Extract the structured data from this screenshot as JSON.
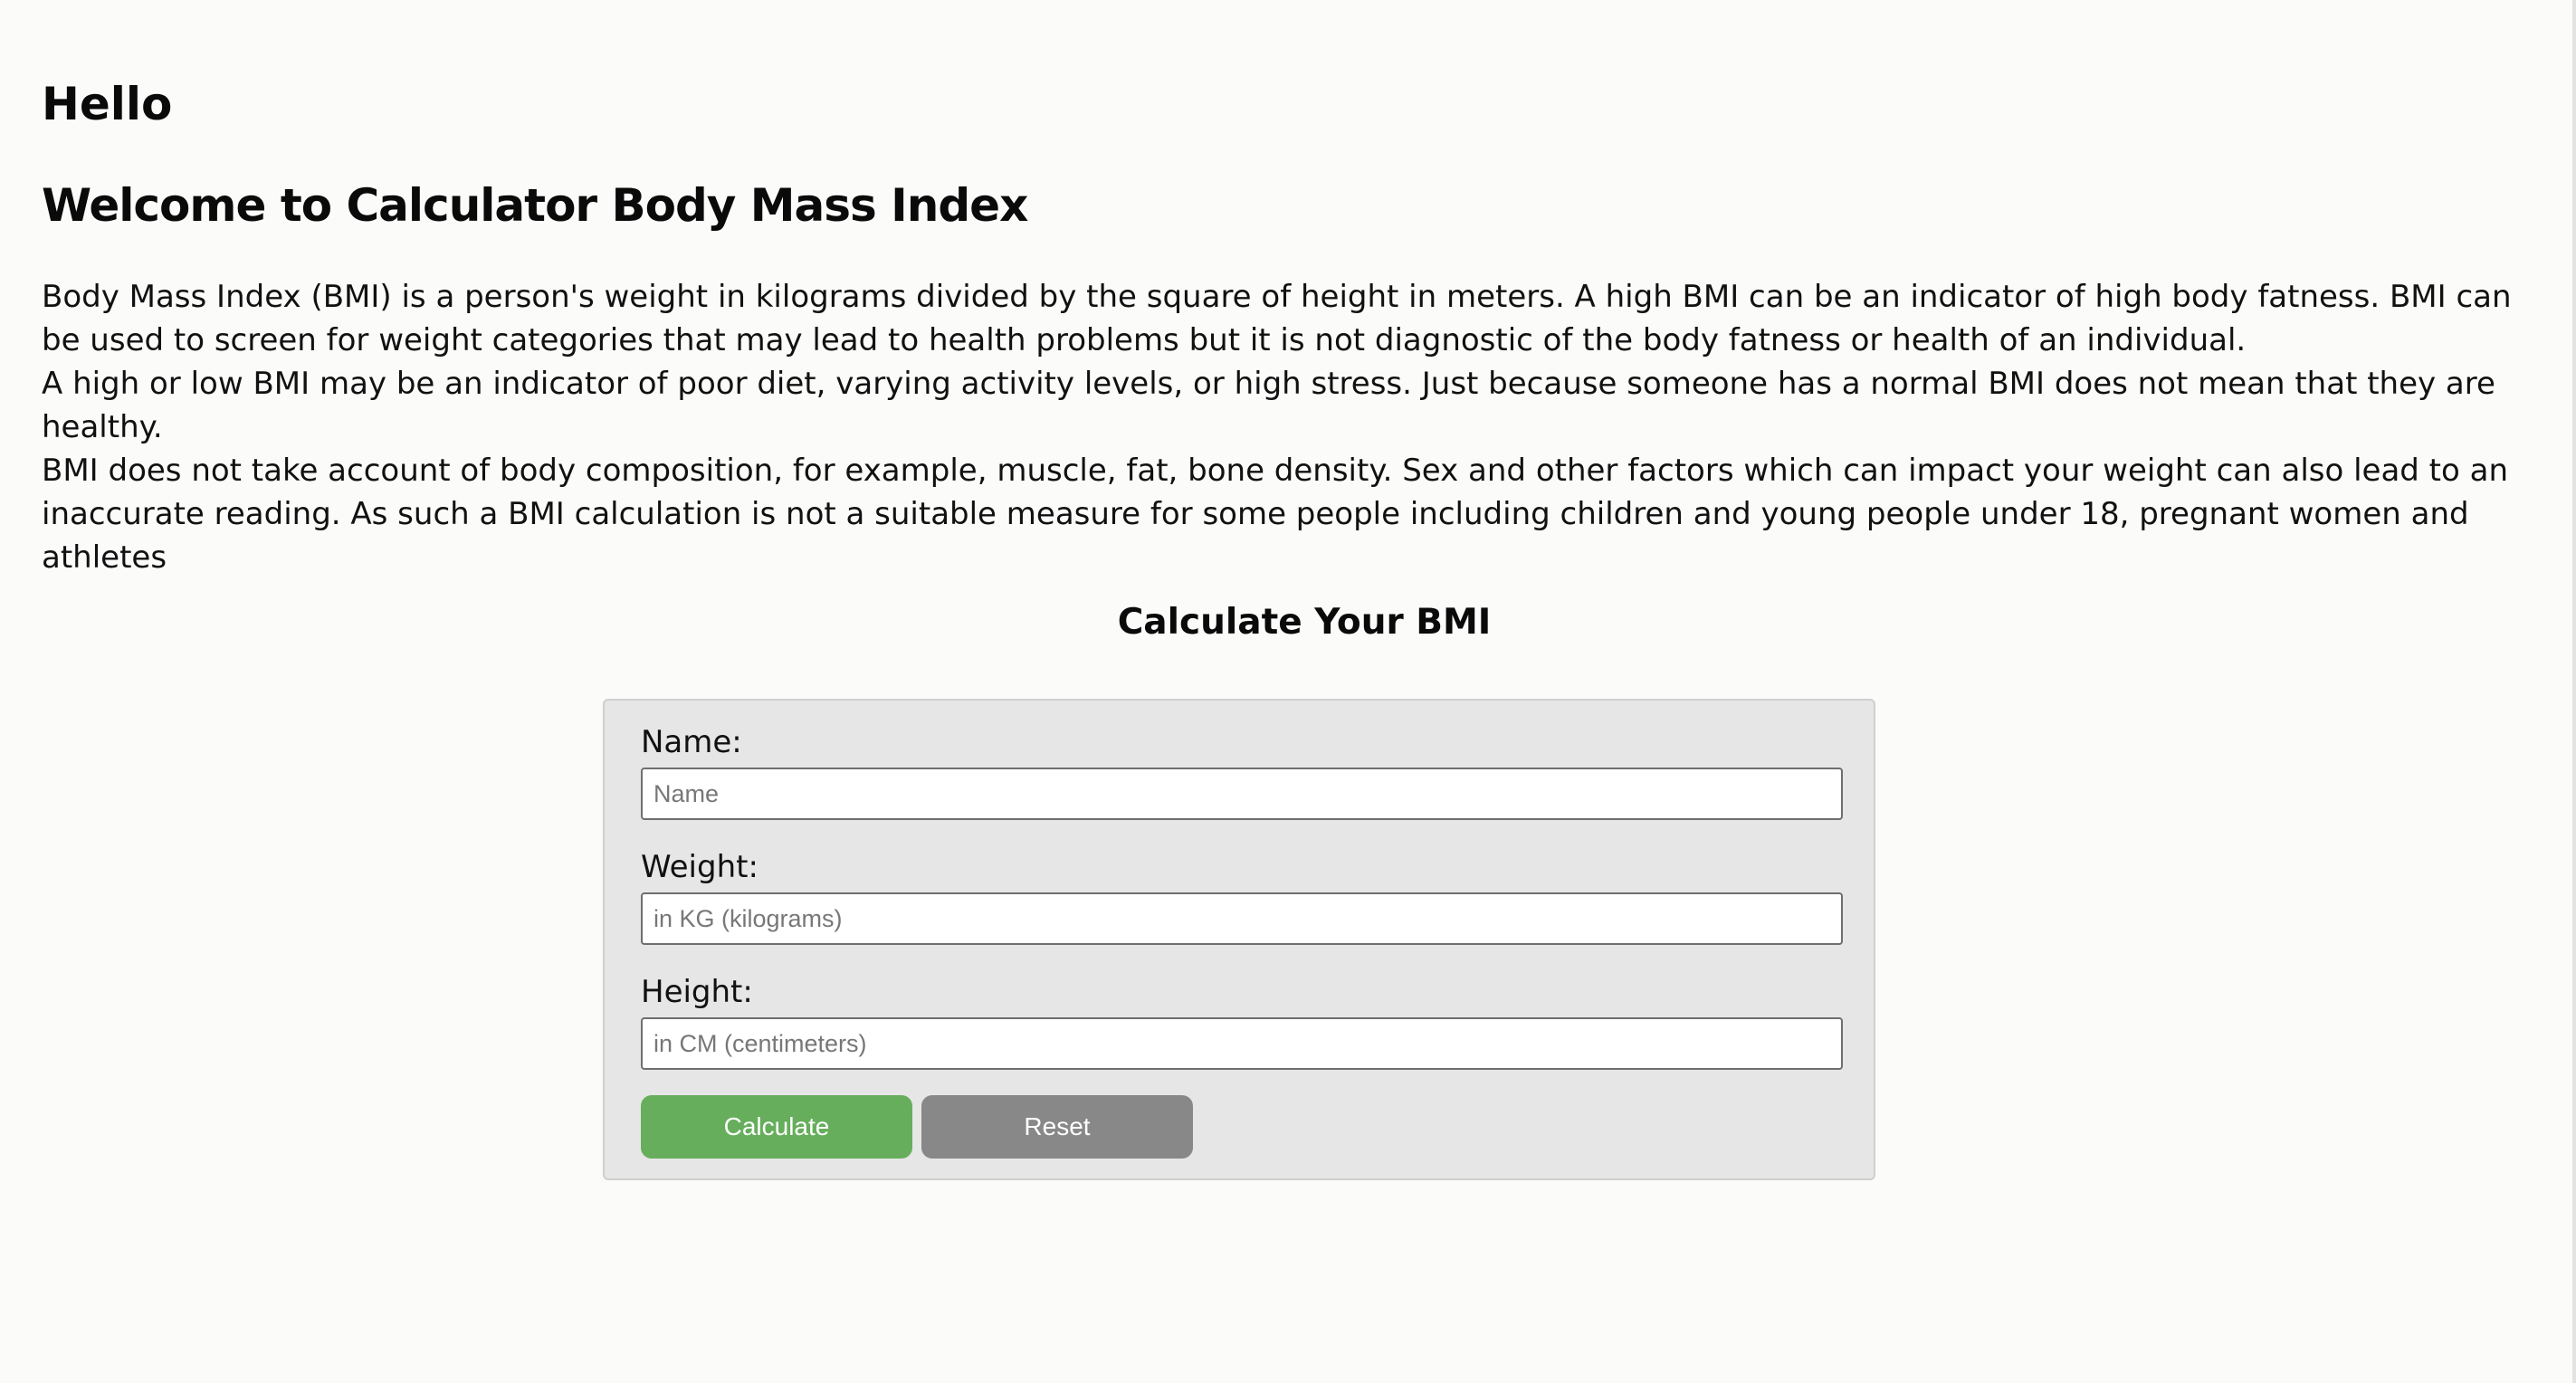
{
  "page": {
    "greeting": "Hello",
    "heading": "Welcome to Calculator Body Mass Index",
    "intro_paragraphs": [
      "Body Mass Index (BMI) is a person's weight in kilograms divided by the square of height in meters. A high BMI can be an indicator of high body fatness. BMI can be used to screen for weight categories that may lead to health problems but it is not diagnostic of the body fatness or health of an individual.",
      "A high or low BMI may be an indicator of poor diet, varying activity levels, or high stress. Just because someone has a normal BMI does not mean that they are healthy.",
      "BMI does not take account of body composition, for example, muscle, fat, bone density. Sex and other factors which can impact your weight can also lead to an inaccurate reading. As such a BMI calculation is not a suitable measure for some people including children and young people under 18, pregnant women and athletes"
    ]
  },
  "calculator": {
    "title": "Calculate Your BMI",
    "fields": {
      "name": {
        "label": "Name:",
        "placeholder": "Name",
        "value": ""
      },
      "weight": {
        "label": "Weight:",
        "placeholder": "in KG (kilograms)",
        "value": ""
      },
      "height": {
        "label": "Height:",
        "placeholder": "in CM (centimeters)",
        "value": ""
      }
    },
    "buttons": {
      "calculate": "Calculate",
      "reset": "Reset"
    }
  },
  "colors": {
    "background": "#fbfcfa",
    "form_background": "#e6e6e6",
    "calculate_button": "#66ae5c",
    "reset_button": "#888888"
  }
}
